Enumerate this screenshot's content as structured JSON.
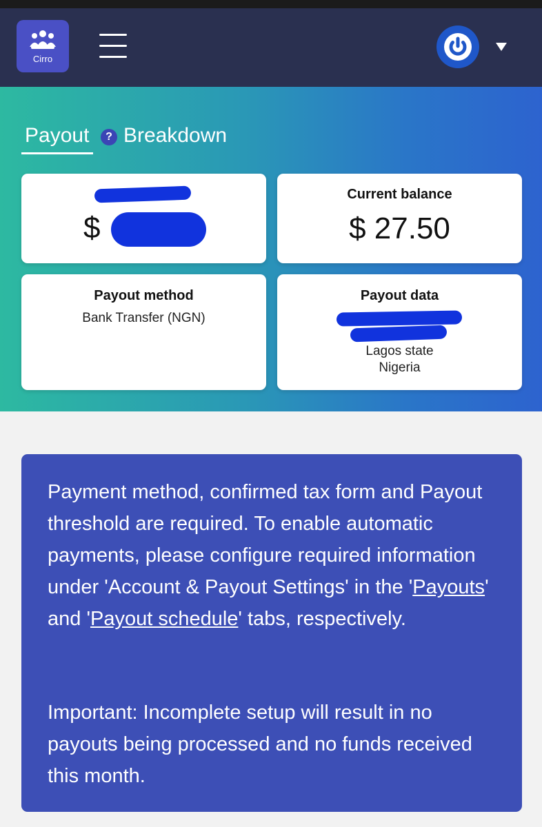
{
  "header": {
    "logo_text": "Cirro",
    "menu_icon": "hamburger-menu-icon",
    "account_icon": "power-icon",
    "dropdown_icon": "caret-down-icon",
    "colors": {
      "bar": "#2a3050",
      "logo": "#4a50c5",
      "avatar": "#1f57c9"
    }
  },
  "tabs": {
    "payout": "Payout",
    "help": "?",
    "breakdown": "Breakdown"
  },
  "cards": {
    "pending": {
      "currency": "$"
    },
    "balance": {
      "label": "Current balance",
      "value": "$ 27.50"
    },
    "method": {
      "label": "Payout method",
      "value": "Bank Transfer (NGN)"
    },
    "data": {
      "label": "Payout data",
      "line1": "Lagos state",
      "line2": "Nigeria"
    }
  },
  "notice": {
    "p1_pre": "Payment method, confirmed tax form and Payout threshold are required. To enable automatic payments, please configure required information under 'Account & Payout Settings' in the '",
    "link1": "Payouts",
    "p1_mid": "' and '",
    "link2": "Payout schedule",
    "p1_post": "' tabs, respectively.",
    "p2": "Important: Incomplete setup will result in no payouts being processed and no funds received this month.",
    "background": "#3d4fb6"
  }
}
